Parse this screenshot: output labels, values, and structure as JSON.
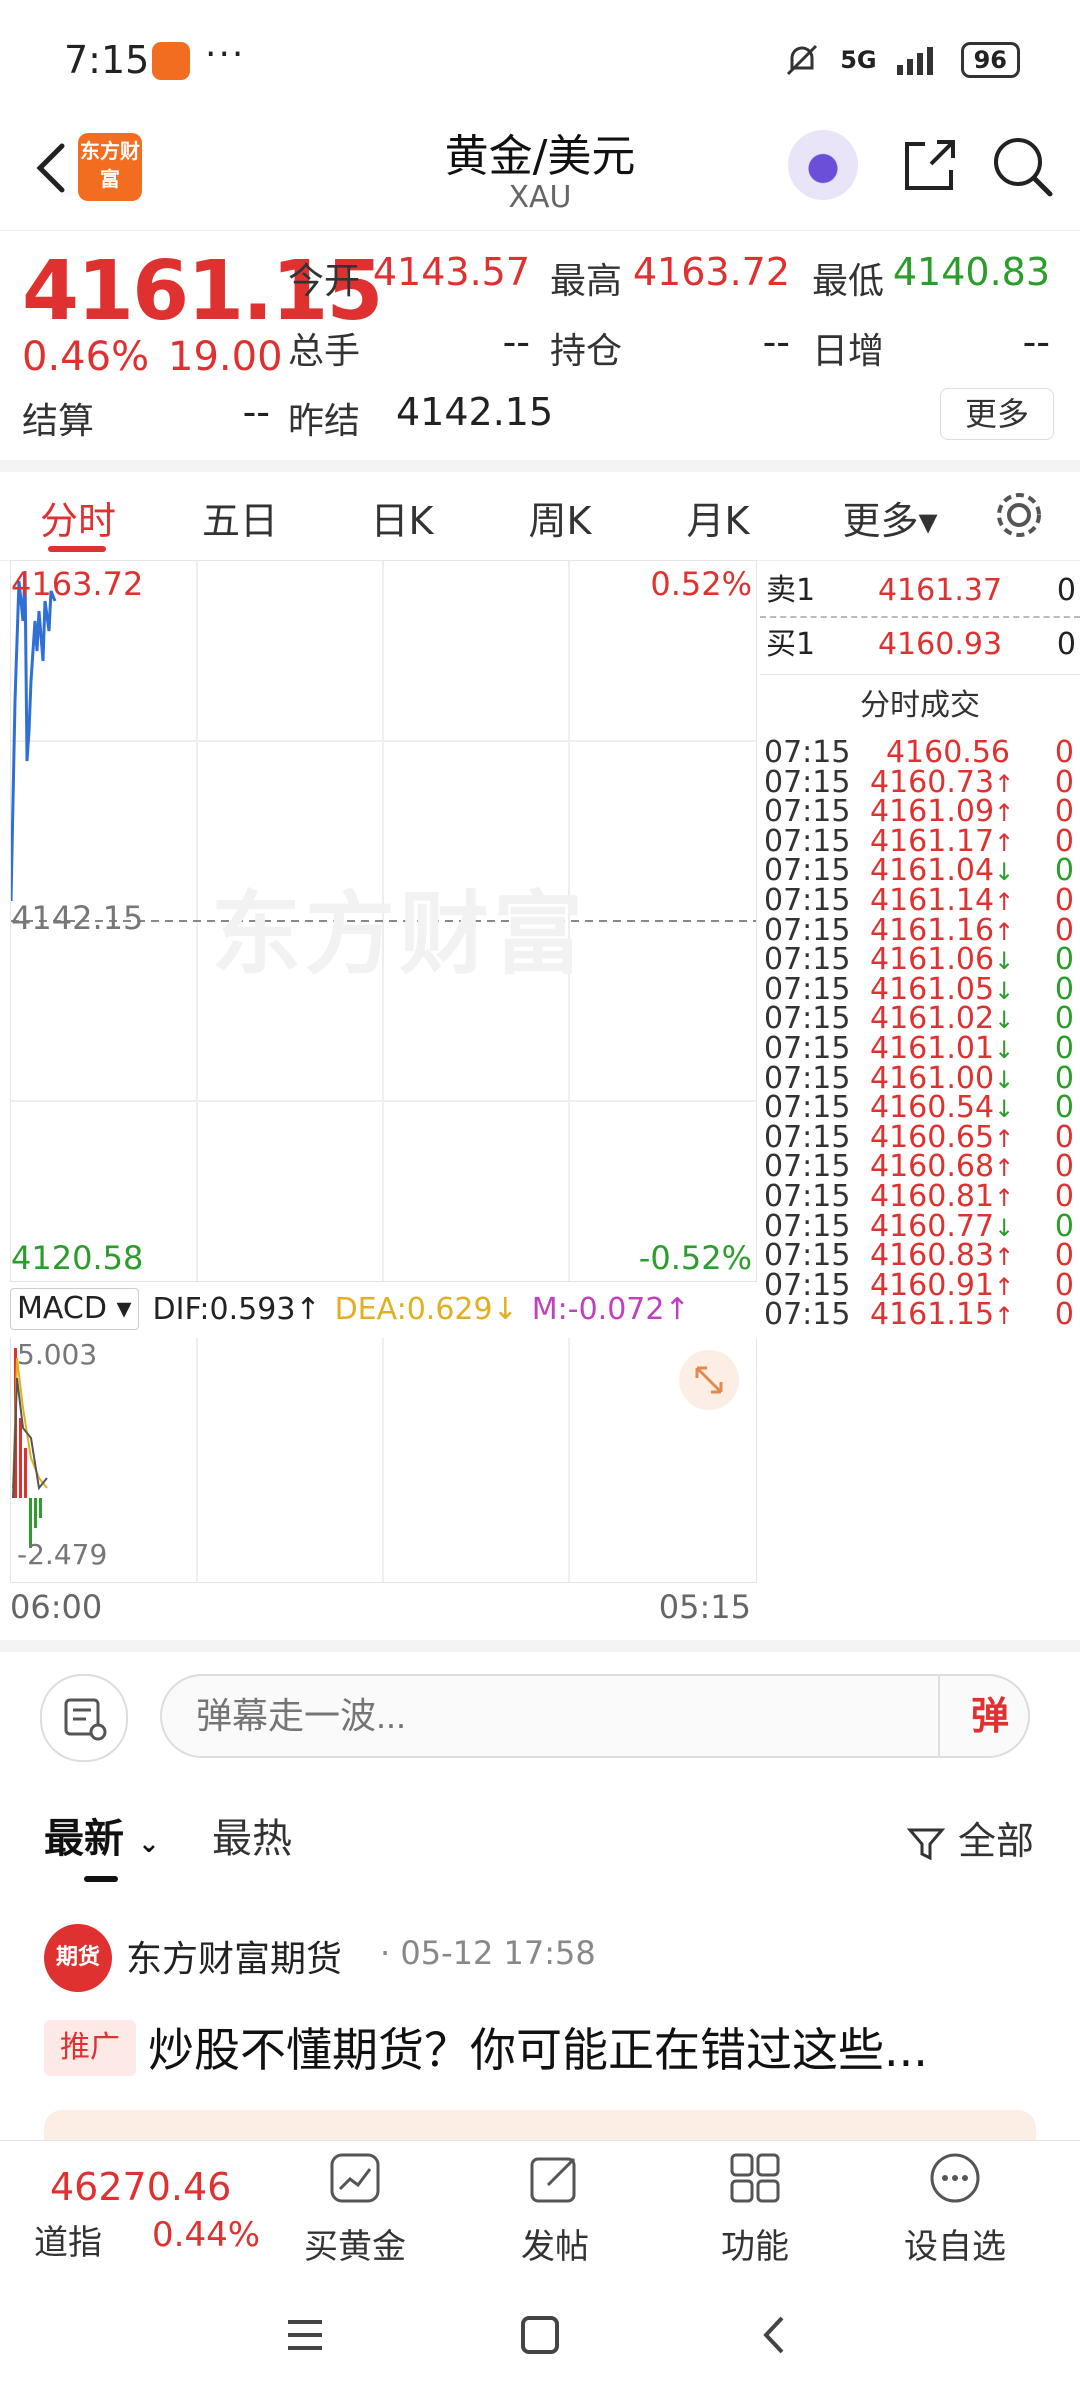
{
  "status_bar": {
    "time": "7:15",
    "overflow": "···",
    "network": "5G",
    "battery": "96"
  },
  "header": {
    "logo_text": "东方财富",
    "title": "黄金/美元",
    "subtitle": "XAU"
  },
  "quote": {
    "price": "4161.15",
    "change_pct": "0.46%",
    "change": "19.00",
    "open_label": "今开",
    "open": "4143.57",
    "high_label": "最高",
    "high": "4163.72",
    "low_label": "最低",
    "low": "4140.83",
    "volume_label": "总手",
    "volume": "--",
    "position_label": "持仓",
    "position": "--",
    "daily_inc_label": "日增",
    "daily_inc": "--",
    "settle_label": "结算",
    "settle": "--",
    "prev_settle_label": "昨结",
    "prev_settle": "4142.15",
    "more_button": "更多"
  },
  "tabs": [
    "分时",
    "五日",
    "日K",
    "周K",
    "月K",
    "更多▾"
  ],
  "chart": {
    "high_label": "4163.72",
    "high_pct": "0.52%",
    "mid_label": "4142.15",
    "low_label": "4120.58",
    "low_pct": "-0.52%",
    "watermark": "东方财富",
    "macd_selector": "MACD",
    "dif": "DIF:0.593↑",
    "dea": "DEA:0.629↓",
    "m": "M:-0.072↑",
    "macd_top": "5.003",
    "macd_bottom": "-2.479",
    "x_start": "06:00",
    "x_end": "05:15"
  },
  "order_book": {
    "ask_label": "卖1",
    "ask_price": "4161.37",
    "ask_vol": "0",
    "bid_label": "买1",
    "bid_price": "4160.93",
    "bid_vol": "0",
    "trades_title": "分时成交",
    "trades": [
      {
        "time": "07:15",
        "price": "4160.56",
        "vol": "0",
        "dir": "none"
      },
      {
        "time": "07:15",
        "price": "4160.73↑",
        "vol": "0",
        "dir": "up"
      },
      {
        "time": "07:15",
        "price": "4161.09↑",
        "vol": "0",
        "dir": "up"
      },
      {
        "time": "07:15",
        "price": "4161.17↑",
        "vol": "0",
        "dir": "up"
      },
      {
        "time": "07:15",
        "price": "4161.04↓",
        "vol": "0",
        "dir": "down"
      },
      {
        "time": "07:15",
        "price": "4161.14↑",
        "vol": "0",
        "dir": "up"
      },
      {
        "time": "07:15",
        "price": "4161.16↑",
        "vol": "0",
        "dir": "up"
      },
      {
        "time": "07:15",
        "price": "4161.06↓",
        "vol": "0",
        "dir": "down"
      },
      {
        "time": "07:15",
        "price": "4161.05↓",
        "vol": "0",
        "dir": "down"
      },
      {
        "time": "07:15",
        "price": "4161.02↓",
        "vol": "0",
        "dir": "down"
      },
      {
        "time": "07:15",
        "price": "4161.01↓",
        "vol": "0",
        "dir": "down"
      },
      {
        "time": "07:15",
        "price": "4161.00↓",
        "vol": "0",
        "dir": "down"
      },
      {
        "time": "07:15",
        "price": "4160.54↓",
        "vol": "0",
        "dir": "down"
      },
      {
        "time": "07:15",
        "price": "4160.65↑",
        "vol": "0",
        "dir": "up"
      },
      {
        "time": "07:15",
        "price": "4160.68↑",
        "vol": "0",
        "dir": "up"
      },
      {
        "time": "07:15",
        "price": "4160.81↑",
        "vol": "0",
        "dir": "up"
      },
      {
        "time": "07:15",
        "price": "4160.77↓",
        "vol": "0",
        "dir": "down"
      },
      {
        "time": "07:15",
        "price": "4160.83↑",
        "vol": "0",
        "dir": "up"
      },
      {
        "time": "07:15",
        "price": "4160.91↑",
        "vol": "0",
        "dir": "up"
      },
      {
        "time": "07:15",
        "price": "4161.15↑",
        "vol": "0",
        "dir": "up"
      }
    ]
  },
  "comment": {
    "placeholder": "弹幕走一波...",
    "danmu": "弹"
  },
  "feed": {
    "tab_latest": "最新",
    "tab_hot": "最热",
    "filter": "全部",
    "post": {
      "avatar_text": "期货",
      "author": "东方财富期货",
      "date": "· 05-12 17:58",
      "tag": "推广",
      "title": "炒股不懂期货？你可能正在错过这些..."
    }
  },
  "toolbar": {
    "index_value": "46270.46",
    "index_name": "道指",
    "index_change": "0.44%",
    "buttons": [
      "买黄金",
      "发帖",
      "功能",
      "设自选"
    ]
  },
  "colors": {
    "up": "#e03131",
    "down": "#2a9d2a",
    "brand": "#f36d21"
  }
}
